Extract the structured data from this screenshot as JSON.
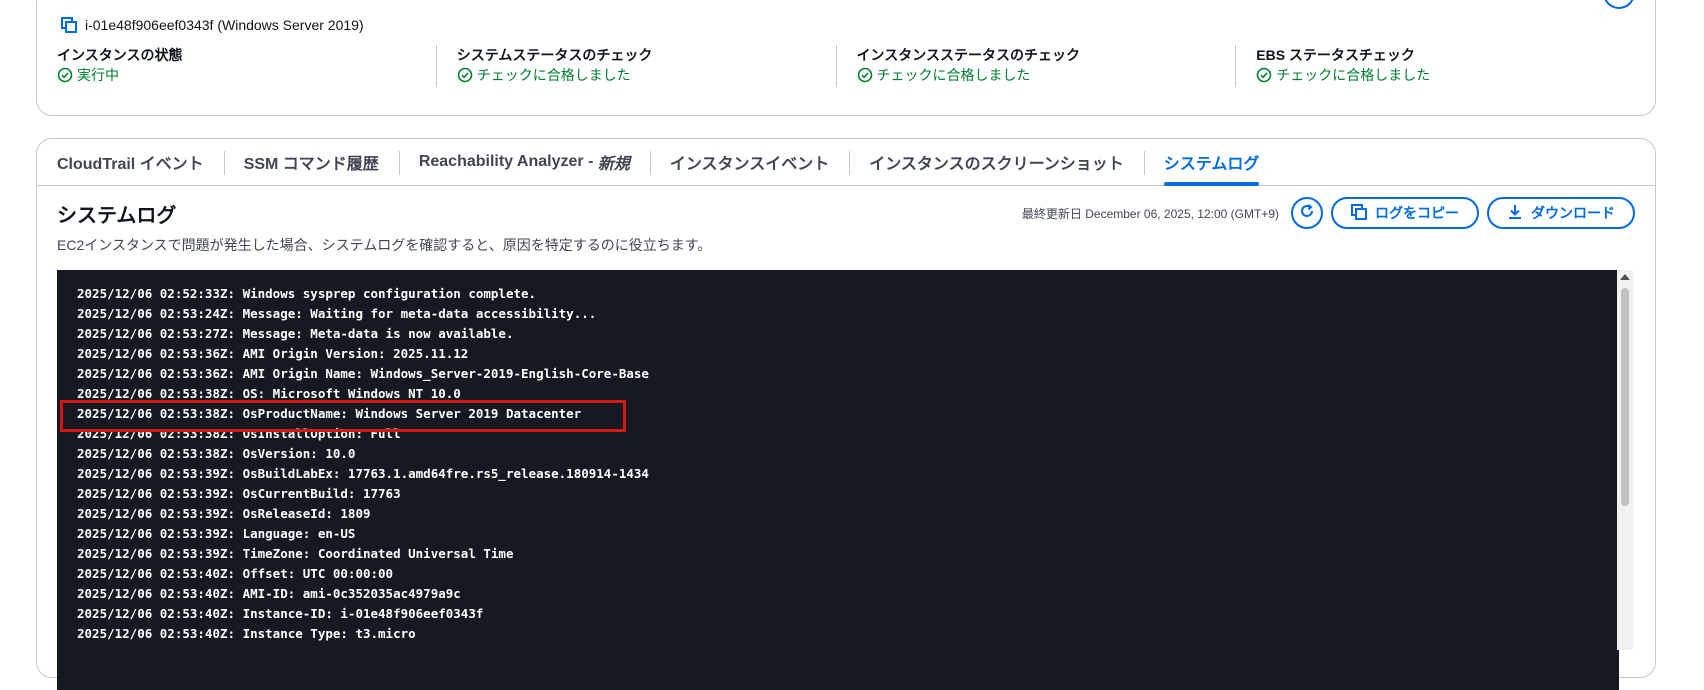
{
  "instance": {
    "label": "i-01e48f906eef0343f (Windows Server 2019)"
  },
  "status": [
    {
      "title": "インスタンスの状態",
      "value": "実行中"
    },
    {
      "title": "システムステータスのチェック",
      "value": "チェックに合格しました"
    },
    {
      "title": "インスタンスステータスのチェック",
      "value": "チェックに合格しました"
    },
    {
      "title": "EBS ステータスチェック",
      "value": "チェックに合格しました"
    }
  ],
  "tabs": [
    {
      "label": "CloudTrail イベント"
    },
    {
      "label": "SSM コマンド履歴"
    },
    {
      "label": "Reachability Analyzer - ",
      "italic": "新規"
    },
    {
      "label": "インスタンスイベント"
    },
    {
      "label": "インスタンスのスクリーンショット"
    },
    {
      "label": "システムログ",
      "active": true
    }
  ],
  "section": {
    "title": "システムログ",
    "description": "EC2インスタンスで問題が発生した場合、システムログを確認すると、原因を特定するのに役立ちます。",
    "last_updated": "最終更新日 December 06, 2025, 12:00 (GMT+9)",
    "copy_label": "ログをコピー",
    "download_label": "ダウンロード"
  },
  "log": [
    "2025/12/06 02:52:33Z: Windows sysprep configuration complete.",
    "2025/12/06 02:53:24Z: Message: Waiting for meta-data accessibility...",
    "2025/12/06 02:53:27Z: Message: Meta-data is now available.",
    "2025/12/06 02:53:36Z: AMI Origin Version: 2025.11.12",
    "2025/12/06 02:53:36Z: AMI Origin Name: Windows_Server-2019-English-Core-Base",
    "2025/12/06 02:53:38Z: OS: Microsoft Windows NT 10.0",
    "2025/12/06 02:53:38Z: OsProductName: Windows Server 2019 Datacenter",
    "2025/12/06 02:53:38Z: OsInstallOption: Full",
    "2025/12/06 02:53:38Z: OsVersion: 10.0",
    "2025/12/06 02:53:39Z: OsBuildLabEx: 17763.1.amd64fre.rs5_release.180914-1434",
    "2025/12/06 02:53:39Z: OsCurrentBuild: 17763",
    "2025/12/06 02:53:39Z: OsReleaseId: 1809",
    "2025/12/06 02:53:39Z: Language: en-US",
    "2025/12/06 02:53:39Z: TimeZone: Coordinated Universal Time",
    "2025/12/06 02:53:40Z: Offset: UTC 00:00:00",
    "2025/12/06 02:53:40Z: AMI-ID: ami-0c352035ac4979a9c",
    "2025/12/06 02:53:40Z: Instance-ID: i-01e48f906eef0343f",
    "2025/12/06 02:53:40Z: Instance Type: t3.micro"
  ],
  "colors": {
    "accent": "#006ce0",
    "success": "#00802f",
    "highlight": "#d91515",
    "log_background": "#151a22"
  }
}
